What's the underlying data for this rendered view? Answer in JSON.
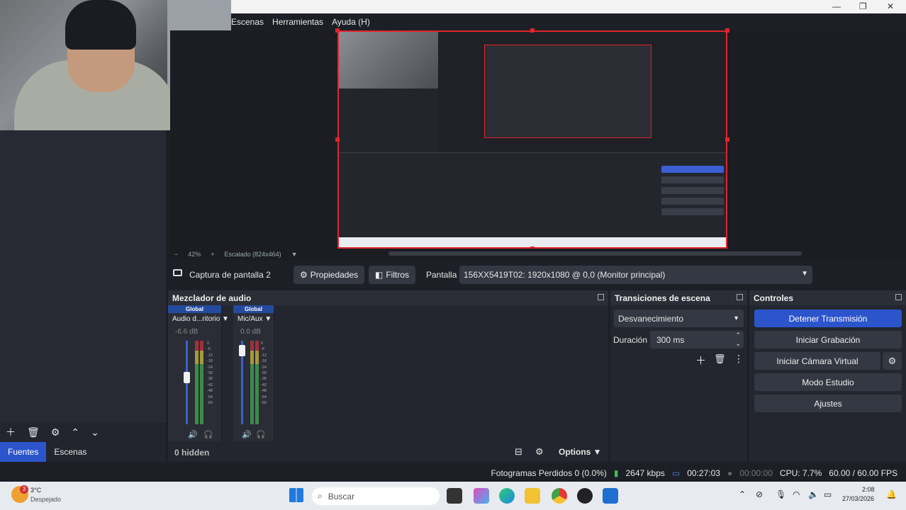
{
  "menu": [
    "Escenas",
    "Herramientas",
    "Ayuda (H)"
  ],
  "window_controls": {
    "minimize": "—",
    "maximize": "❐",
    "close": "✕"
  },
  "preview": {
    "zoom": "42%",
    "scale_label": "Escalado (824x464)",
    "minus": "−",
    "plus": "+"
  },
  "left_panel": {
    "tabs": [
      "Fuentes",
      "Escenas"
    ],
    "active_tab": "Fuentes",
    "toolbar_icons": [
      "plus-icon",
      "trash-icon",
      "gear-icon",
      "arrow-up-icon",
      "arrow-down-icon"
    ]
  },
  "context_bar": {
    "source_name": "Captura de pantalla 2",
    "properties_label": "Propiedades",
    "filters_label": "Filtros",
    "display_label": "Pantalla",
    "display_value": "156XX5419T02: 1920x1080 @ 0,0 (Monitor principal)"
  },
  "mixer": {
    "title": "Mezclador de audio",
    "channels": [
      {
        "tag": "Global",
        "name": "Audio d...ritorio",
        "db": "-6.6 dB",
        "level": 0.6
      },
      {
        "tag": "Global",
        "name": "Mic/Aux",
        "db": "0.0 dB",
        "level": 0.95
      }
    ],
    "scale": [
      "0",
      "-6",
      "-12",
      "-18",
      "-24",
      "-30",
      "-36",
      "-42",
      "-48",
      "-54",
      "-60"
    ],
    "hidden_label": "0 hidden",
    "options_label": "Options"
  },
  "transitions": {
    "title": "Transiciones de escena",
    "selected": "Desvanecimiento",
    "duration_label": "Duración",
    "duration_value": "300 ms"
  },
  "controls": {
    "title": "Controles",
    "buttons": [
      "Detener Transmisión",
      "Iniciar Grabación",
      "Iniciar Cámara Virtual",
      "Modo Estudio",
      "Ajustes"
    ]
  },
  "status": {
    "dropped": "Fotogramas Perdidos 0 (0.0%)",
    "bitrate": "2647 kbps",
    "stream_time": "00:27:03",
    "rec_time": "00:00:00",
    "cpu": "CPU: 7.7%",
    "fps": "60.00 / 60.00 FPS"
  },
  "taskbar": {
    "weather_temp": "3°C",
    "weather_desc": "Despejado",
    "weather_badge": "3",
    "search_placeholder": "Buscar",
    "time": "2:08",
    "date": "27/03/2026"
  },
  "colors": {
    "accent": "#2c55cc",
    "selection": "#e0242b",
    "panel": "#23262e"
  }
}
